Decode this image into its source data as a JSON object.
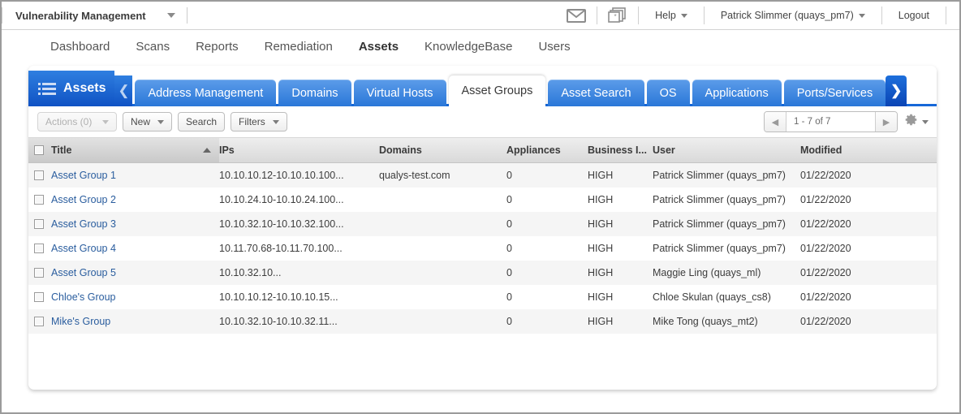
{
  "appbar": {
    "module_title": "Vulnerability Management",
    "mail_icon": "envelope-icon",
    "apps_icon": "apps-icon",
    "help_label": "Help",
    "user_label": "Patrick Slimmer (quays_pm7)",
    "logout_label": "Logout"
  },
  "mainnav": {
    "items": [
      {
        "label": "Dashboard",
        "active": false
      },
      {
        "label": "Scans",
        "active": false
      },
      {
        "label": "Reports",
        "active": false
      },
      {
        "label": "Remediation",
        "active": false
      },
      {
        "label": "Assets",
        "active": true
      },
      {
        "label": "KnowledgeBase",
        "active": false
      },
      {
        "label": "Users",
        "active": false
      }
    ]
  },
  "tabstrip": {
    "section_label": "Assets",
    "section_icon": "list-icon",
    "prev_arrow": "chevron-left-icon",
    "next_arrow": "chevron-right-icon",
    "tabs": [
      {
        "label": "Address Management",
        "active": false
      },
      {
        "label": "Domains",
        "active": false
      },
      {
        "label": "Virtual Hosts",
        "active": false
      },
      {
        "label": "Asset Groups",
        "active": true
      },
      {
        "label": "Asset Search",
        "active": false
      },
      {
        "label": "OS",
        "active": false
      },
      {
        "label": "Applications",
        "active": false
      },
      {
        "label": "Ports/Services",
        "active": false
      }
    ]
  },
  "toolbar": {
    "actions_label": "Actions (0)",
    "new_label": "New",
    "search_label": "Search",
    "filters_label": "Filters",
    "pager": {
      "prev_icon": "triangle-left-icon",
      "next_icon": "triangle-right-icon",
      "range_text": "1 - 7 of 7"
    },
    "gear_icon": "gear-icon",
    "gear_caret": "chevron-down-icon"
  },
  "table": {
    "sort_column": "Title",
    "sort_direction": "asc",
    "select_all_checkbox": false,
    "columns": [
      {
        "key": "title",
        "label": "Title"
      },
      {
        "key": "ips",
        "label": "IPs"
      },
      {
        "key": "domains",
        "label": "Domains"
      },
      {
        "key": "appliances",
        "label": "Appliances"
      },
      {
        "key": "business",
        "label": "Business I..."
      },
      {
        "key": "user",
        "label": "User"
      },
      {
        "key": "modified",
        "label": "Modified"
      }
    ],
    "rows": [
      {
        "title": "Asset Group 1",
        "ips": "10.10.10.12-10.10.10.100...",
        "domains": "qualys-test.com",
        "appliances": "0",
        "business": "HIGH",
        "user": "Patrick Slimmer (quays_pm7)",
        "modified": "01/22/2020"
      },
      {
        "title": "Asset Group 2",
        "ips": "10.10.24.10-10.10.24.100...",
        "domains": "",
        "appliances": "0",
        "business": "HIGH",
        "user": "Patrick Slimmer (quays_pm7)",
        "modified": "01/22/2020"
      },
      {
        "title": "Asset Group 3",
        "ips": "10.10.32.10-10.10.32.100...",
        "domains": "",
        "appliances": "0",
        "business": "HIGH",
        "user": "Patrick Slimmer (quays_pm7)",
        "modified": "01/22/2020"
      },
      {
        "title": "Asset Group 4",
        "ips": "10.11.70.68-10.11.70.100...",
        "domains": "",
        "appliances": "0",
        "business": "HIGH",
        "user": "Patrick Slimmer (quays_pm7)",
        "modified": "01/22/2020"
      },
      {
        "title": "Asset Group 5",
        "ips": "10.10.32.10...",
        "domains": "",
        "appliances": "0",
        "business": "HIGH",
        "user": "Maggie Ling (quays_ml)",
        "modified": "01/22/2020"
      },
      {
        "title": "Chloe's Group",
        "ips": "10.10.10.12-10.10.10.15...",
        "domains": "",
        "appliances": "0",
        "business": "HIGH",
        "user": "Chloe Skulan (quays_cs8)",
        "modified": "01/22/2020"
      },
      {
        "title": "Mike's Group",
        "ips": "10.10.32.10-10.10.32.11...",
        "domains": "",
        "appliances": "0",
        "business": "HIGH",
        "user": "Mike Tong (quays_mt2)",
        "modified": "01/22/2020"
      }
    ]
  },
  "colors": {
    "brand_blue": "#2f7fe0",
    "brand_blue_dark": "#0f52c4",
    "link": "#2a5d9e",
    "row_alt": "#f5f5f5"
  }
}
